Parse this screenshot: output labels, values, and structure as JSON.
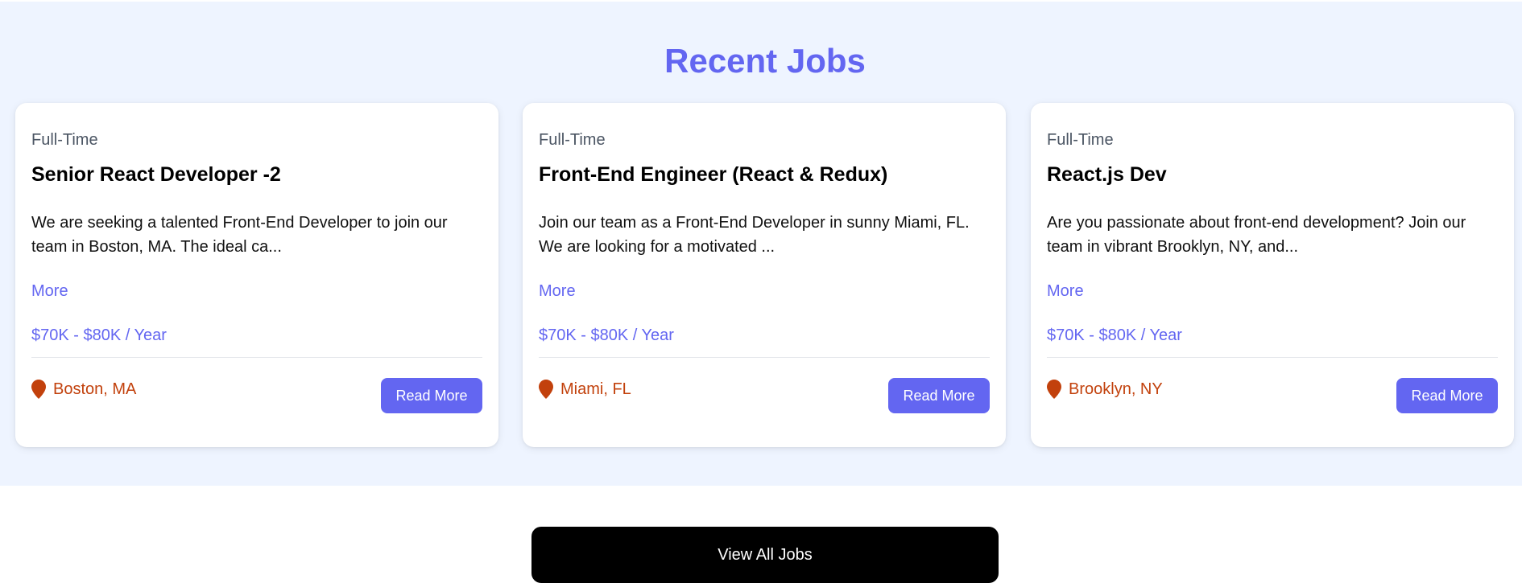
{
  "section": {
    "title": "Recent Jobs"
  },
  "jobs": [
    {
      "type": "Full-Time",
      "title": "Senior React Developer -2",
      "description": "We are seeking a talented Front-End Developer to join our team in Boston, MA. The ideal ca...",
      "more_label": "More",
      "salary": "$70K - $80K / Year",
      "location": "Boston, MA",
      "location_icon": "map-pin-icon",
      "button_label": "Read More"
    },
    {
      "type": "Full-Time",
      "title": "Front-End Engineer (React & Redux)",
      "description": "Join our team as a Front-End Developer in sunny Miami, FL. We are looking for a motivated ...",
      "more_label": "More",
      "salary": "$70K - $80K / Year",
      "location": "Miami, FL",
      "location_icon": "map-pin-icon",
      "button_label": "Read More"
    },
    {
      "type": "Full-Time",
      "title": "React.js Dev",
      "description": "Are you passionate about front-end development? Join our team in vibrant Brooklyn, NY, and...",
      "more_label": "More",
      "salary": "$70K - $80K / Year",
      "location": "Brooklyn, NY",
      "location_icon": "map-pin-icon",
      "button_label": "Read More"
    }
  ],
  "footer": {
    "view_all_label": "View All Jobs"
  },
  "colors": {
    "accent": "#6366f1",
    "section_background": "#eef4ff",
    "location": "#c2410c",
    "view_all_background": "#000000"
  }
}
